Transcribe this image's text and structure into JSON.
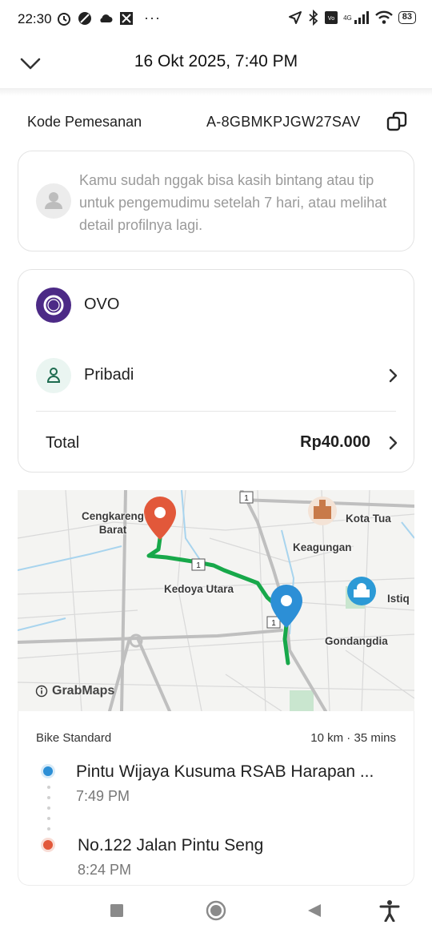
{
  "status_bar": {
    "time": "22:30",
    "more": "···",
    "battery": "83",
    "network": "4G"
  },
  "header": {
    "title": "16 Okt 2025, 7:40 PM"
  },
  "booking": {
    "label": "Kode Pemesanan",
    "code": "A-8GBMKPJGW27SAV"
  },
  "notice": {
    "text": "Kamu sudah nggak bisa kasih bintang atau tip untuk pengemudimu setelah 7 hari, atau melihat detail profilnya lagi."
  },
  "payment": {
    "method": "OVO",
    "profile": "Pribadi",
    "total_label": "Total",
    "total_value": "Rp40.000"
  },
  "map": {
    "labels": {
      "cengkareng": "Cengkareng\nBarat",
      "kota_tua": "Kota Tua",
      "keagungan": "Keagungan",
      "kedoya": "Kedoya Utara",
      "istiq": "Istiq",
      "gondangdia": "Gondangdia"
    },
    "road_badge": "1",
    "attribution": "GrabMaps",
    "colors": {
      "route": "#17a84a",
      "pickup_pin": "#2c8fd6",
      "drop_pin": "#e2583a"
    }
  },
  "trip": {
    "type": "Bike Standard",
    "meta": "10 km · 35 mins",
    "pickup": {
      "address": "Pintu Wijaya Kusuma RSAB Harapan ...",
      "time": "7:49 PM"
    },
    "dropoff": {
      "address": "No.122 Jalan Pintu Seng",
      "time": "8:24 PM"
    }
  },
  "navbar": {
    "icons": [
      "recents-icon",
      "home-icon",
      "back-icon",
      "accessibility-icon"
    ]
  }
}
